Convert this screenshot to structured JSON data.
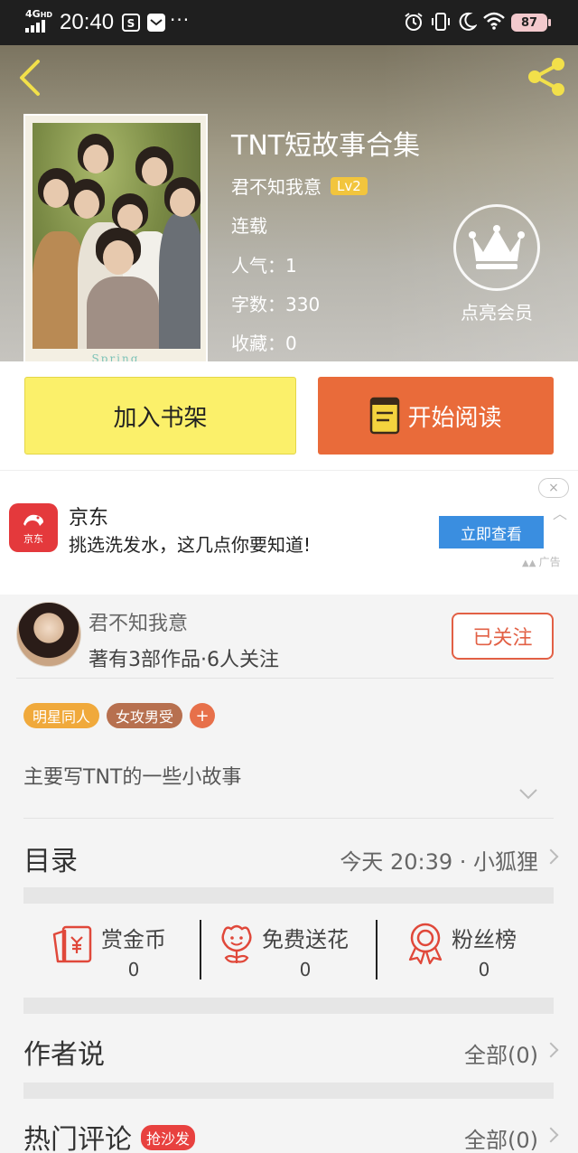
{
  "status_bar": {
    "network": "4G",
    "network_extra": "HD",
    "time": "20:40",
    "battery": "87"
  },
  "book": {
    "title": "TNT短故事合集",
    "author": "君不知我意",
    "level": "Lv2",
    "status": "连载",
    "popularity_label": "人气：",
    "popularity": "1",
    "words_label": "字数：",
    "words": "330",
    "favorites_label": "收藏：",
    "favorites": "0",
    "cover_text": "Spring"
  },
  "vip": {
    "label": "点亮会员"
  },
  "actions": {
    "add_shelf": "加入书架",
    "start_reading": "开始阅读"
  },
  "ad": {
    "brand": "京东",
    "logo_text": "京东",
    "desc": "挑选洗发水，这几点你要知道!",
    "button": "立即查看",
    "tag": "广告",
    "close": "×"
  },
  "author_card": {
    "name": "君不知我意",
    "stats": "著有3部作品·6人关注",
    "follow": "已关注"
  },
  "tags": [
    {
      "label": "明星同人",
      "color": "#f0a93b"
    },
    {
      "label": "女攻男受",
      "color": "#b7704f"
    }
  ],
  "tag_add": "+",
  "intro": "主要写TNT的一些小故事",
  "catalog": {
    "title": "目录",
    "update": "今天 20:39 · 小狐狸"
  },
  "stats": [
    {
      "label": "赏金币",
      "value": "0",
      "icon": "reward-coin-icon"
    },
    {
      "label": "免费送花",
      "value": "0",
      "icon": "flower-icon"
    },
    {
      "label": "粉丝榜",
      "value": "0",
      "icon": "medal-icon"
    }
  ],
  "author_says": {
    "title": "作者说",
    "right": "全部(0)"
  },
  "hot_comments": {
    "title": "热门评论",
    "badge": "抢沙发",
    "right": "全部(0)"
  },
  "colors": {
    "accent_orange": "#e96b3a",
    "shelf_yellow": "#fbf06a",
    "lv_badge": "#f2c53d",
    "follow_red": "#e26045",
    "ad_button": "#3a8ee0",
    "jd_red": "#e4393c",
    "hot_badge": "#e8413f"
  }
}
